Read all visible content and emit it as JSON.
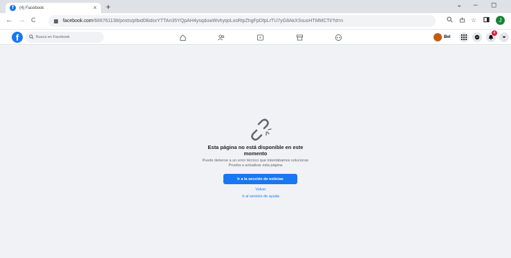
{
  "browser": {
    "tab": {
      "title": "(4) Facebook",
      "close": "×"
    },
    "new_tab": "+",
    "window_controls": {
      "minimize": "–",
      "maximize": "◻",
      "chevron": "⌄"
    },
    "nav": {
      "back": "←",
      "forward": "→",
      "reload": "C"
    },
    "url": {
      "host": "facebook.com",
      "rest": "/666761138/posts/pfbid08idsxYTTAn35YQpAH4ysqduwWvhyqoLxsRtpZhgFpDfpLrTU7yG8AkXSsusHTMMCTl/?d=n"
    },
    "toolbar_icons": [
      "zoom-icon",
      "share-icon",
      "star-icon",
      "sidebar-icon"
    ],
    "profile_initial": "J"
  },
  "facebook": {
    "logo": "f",
    "search": {
      "placeholder": "Busca en Facebook"
    },
    "nav_icons": [
      "home-icon",
      "friends-icon",
      "watch-icon",
      "marketplace-icon",
      "groups-icon"
    ],
    "user": {
      "name": "Bel"
    },
    "notifications_count": "4",
    "accent": "#1877f2"
  },
  "error_page": {
    "heading": "Esta página no está disponible en este momento",
    "description_line1": "Puede deberse a un error técnico que intentábamos solucionar.",
    "description_line2": "Prueba a actualizar esta página.",
    "primary_button": "Ir a la sección de noticias",
    "back_link": "Volver",
    "help_link": "Ir al servicio de ayuda"
  }
}
